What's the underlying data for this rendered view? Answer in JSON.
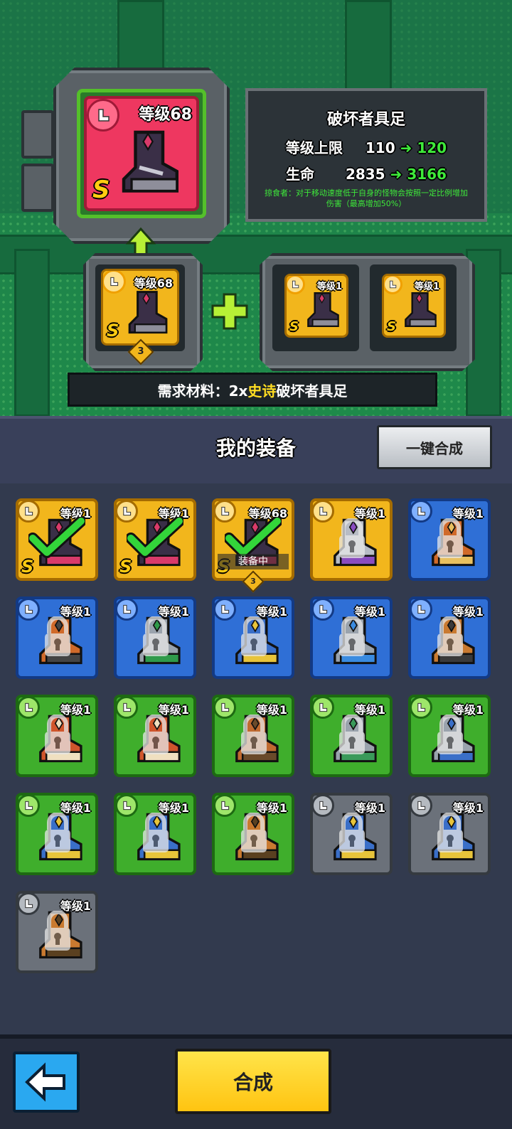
{
  "preview": {
    "result_level": "等级68",
    "base_level": "等级68",
    "base_stars": "3",
    "material_levels": [
      "等级1",
      "等级1"
    ],
    "rank_letter": "S"
  },
  "info": {
    "item_name": "破坏者具足",
    "stat1_label": "等级上限",
    "stat1_from": "110",
    "stat1_to": "120",
    "stat2_label": "生命",
    "stat2_from": "2835",
    "stat2_to": "3166",
    "passive_text_line1": "掠食者：对于移动速度低于自身的怪物会按照一定比例增加",
    "passive_text_line2": "伤害（最高增加50%）"
  },
  "requirement": {
    "prefix": "需求材料：2x",
    "rarity": "史诗",
    "item": "破坏者具足"
  },
  "equipment": {
    "title": "我的装备",
    "auto_merge_label": "一键合成",
    "equipped_label": "装备中",
    "items": [
      {
        "level": "等级1",
        "rarity": "gold",
        "boot": "#3a2f47",
        "trim": "#d93a6a",
        "selected": true,
        "locked": false,
        "rank": "S"
      },
      {
        "level": "等级1",
        "rarity": "gold",
        "boot": "#3a2f47",
        "trim": "#d93a6a",
        "selected": true,
        "locked": false,
        "rank": "S"
      },
      {
        "level": "等级68",
        "rarity": "gold",
        "boot": "#3a2f47",
        "trim": "#d93a6a",
        "selected": true,
        "locked": false,
        "rank": "S",
        "equipped": true,
        "stars": "3"
      },
      {
        "level": "等级1",
        "rarity": "gold",
        "boot": "#b7bcc5",
        "trim": "#8a4cc0",
        "selected": false,
        "locked": true
      },
      {
        "level": "等级1",
        "rarity": "blue",
        "boot": "#d06a2a",
        "trim": "#e8c060",
        "selected": false,
        "locked": true
      },
      {
        "level": "等级1",
        "rarity": "blue",
        "boot": "#d06a2a",
        "trim": "#444",
        "selected": false,
        "locked": true
      },
      {
        "level": "等级1",
        "rarity": "blue",
        "boot": "#9aa3ad",
        "trim": "#2f9a4a",
        "selected": false,
        "locked": true
      },
      {
        "level": "等级1",
        "rarity": "blue",
        "boot": "#3a6fc8",
        "trim": "#e8c43a",
        "selected": false,
        "locked": true
      },
      {
        "level": "等级1",
        "rarity": "blue",
        "boot": "#9aa3ad",
        "trim": "#3a8be0",
        "selected": false,
        "locked": true
      },
      {
        "level": "等级1",
        "rarity": "blue",
        "boot": "#c97a30",
        "trim": "#3a3a3a",
        "selected": false,
        "locked": true
      },
      {
        "level": "等级1",
        "rarity": "green",
        "boot": "#d0552c",
        "trim": "#f0e0c0",
        "selected": false,
        "locked": true
      },
      {
        "level": "等级1",
        "rarity": "green",
        "boot": "#d0552c",
        "trim": "#f0e0c0",
        "selected": false,
        "locked": true
      },
      {
        "level": "等级1",
        "rarity": "green",
        "boot": "#c06a30",
        "trim": "#6a4a2a",
        "selected": false,
        "locked": true
      },
      {
        "level": "等级1",
        "rarity": "green",
        "boot": "#9aa3ad",
        "trim": "#3a9a5a",
        "selected": false,
        "locked": true
      },
      {
        "level": "等级1",
        "rarity": "green",
        "boot": "#9aa3ad",
        "trim": "#3a6fc8",
        "selected": false,
        "locked": true
      },
      {
        "level": "等级1",
        "rarity": "green",
        "boot": "#3a6fc8",
        "trim": "#e8c43a",
        "selected": false,
        "locked": true
      },
      {
        "level": "等级1",
        "rarity": "green",
        "boot": "#3a6fc8",
        "trim": "#e8c43a",
        "selected": false,
        "locked": true
      },
      {
        "level": "等级1",
        "rarity": "green",
        "boot": "#c97a30",
        "trim": "#5a4020",
        "selected": false,
        "locked": true
      },
      {
        "level": "等级1",
        "rarity": "gray",
        "boot": "#3a6fc8",
        "trim": "#e8c43a",
        "selected": false,
        "locked": true
      },
      {
        "level": "等级1",
        "rarity": "gray",
        "boot": "#3a6fc8",
        "trim": "#e8c43a",
        "selected": false,
        "locked": true
      },
      {
        "level": "等级1",
        "rarity": "gray",
        "boot": "#c97a30",
        "trim": "#5a4020",
        "selected": false,
        "locked": true
      }
    ]
  },
  "footer": {
    "merge_label": "合成"
  },
  "colors": {
    "gold_card": "#f2b61c",
    "blue_card": "#2f6fd6",
    "green_card": "#3fae2c",
    "gray_card": "#6b717a",
    "red_card": "#ee3760"
  }
}
